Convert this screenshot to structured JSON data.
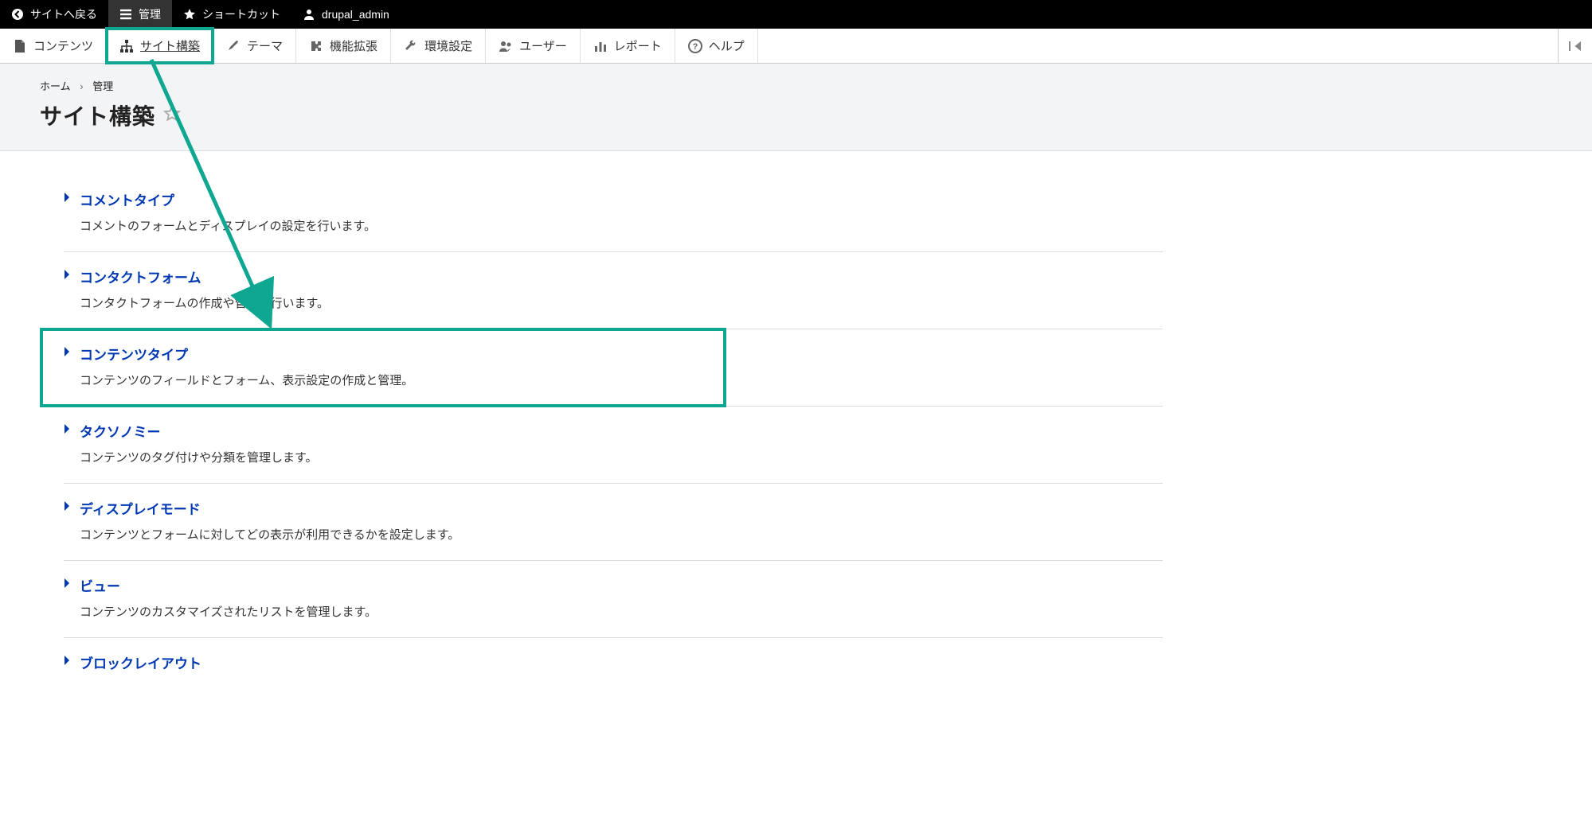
{
  "topbar": {
    "back_to_site": "サイトへ戻る",
    "manage": "管理",
    "shortcuts": "ショートカット",
    "username": "drupal_admin"
  },
  "nav": {
    "items": [
      {
        "label": "コンテンツ",
        "icon": "file"
      },
      {
        "label": "サイト構築",
        "icon": "structure",
        "active": true
      },
      {
        "label": "テーマ",
        "icon": "brush"
      },
      {
        "label": "機能拡張",
        "icon": "puzzle"
      },
      {
        "label": "環境設定",
        "icon": "wrench"
      },
      {
        "label": "ユーザー",
        "icon": "people"
      },
      {
        "label": "レポート",
        "icon": "bar-chart"
      },
      {
        "label": "ヘルプ",
        "icon": "help"
      }
    ]
  },
  "breadcrumb": {
    "home": "ホーム",
    "manage": "管理"
  },
  "page_title": "サイト構築",
  "structure": {
    "items": [
      {
        "title": "コメントタイプ",
        "desc": "コメントのフォームとディスプレイの設定を行います。"
      },
      {
        "title": "コンタクトフォーム",
        "desc": "コンタクトフォームの作成や管理を行います。"
      },
      {
        "title": "コンテンツタイプ",
        "desc": "コンテンツのフィールドとフォーム、表示設定の作成と管理。",
        "highlighted": true
      },
      {
        "title": "タクソノミー",
        "desc": "コンテンツのタグ付けや分類を管理します。"
      },
      {
        "title": "ディスプレイモード",
        "desc": "コンテンツとフォームに対してどの表示が利用できるかを設定します。"
      },
      {
        "title": "ビュー",
        "desc": "コンテンツのカスタマイズされたリストを管理します。"
      },
      {
        "title": "ブロックレイアウト",
        "desc": ""
      }
    ]
  },
  "annotation": {
    "highlight_color": "#0fa792"
  }
}
